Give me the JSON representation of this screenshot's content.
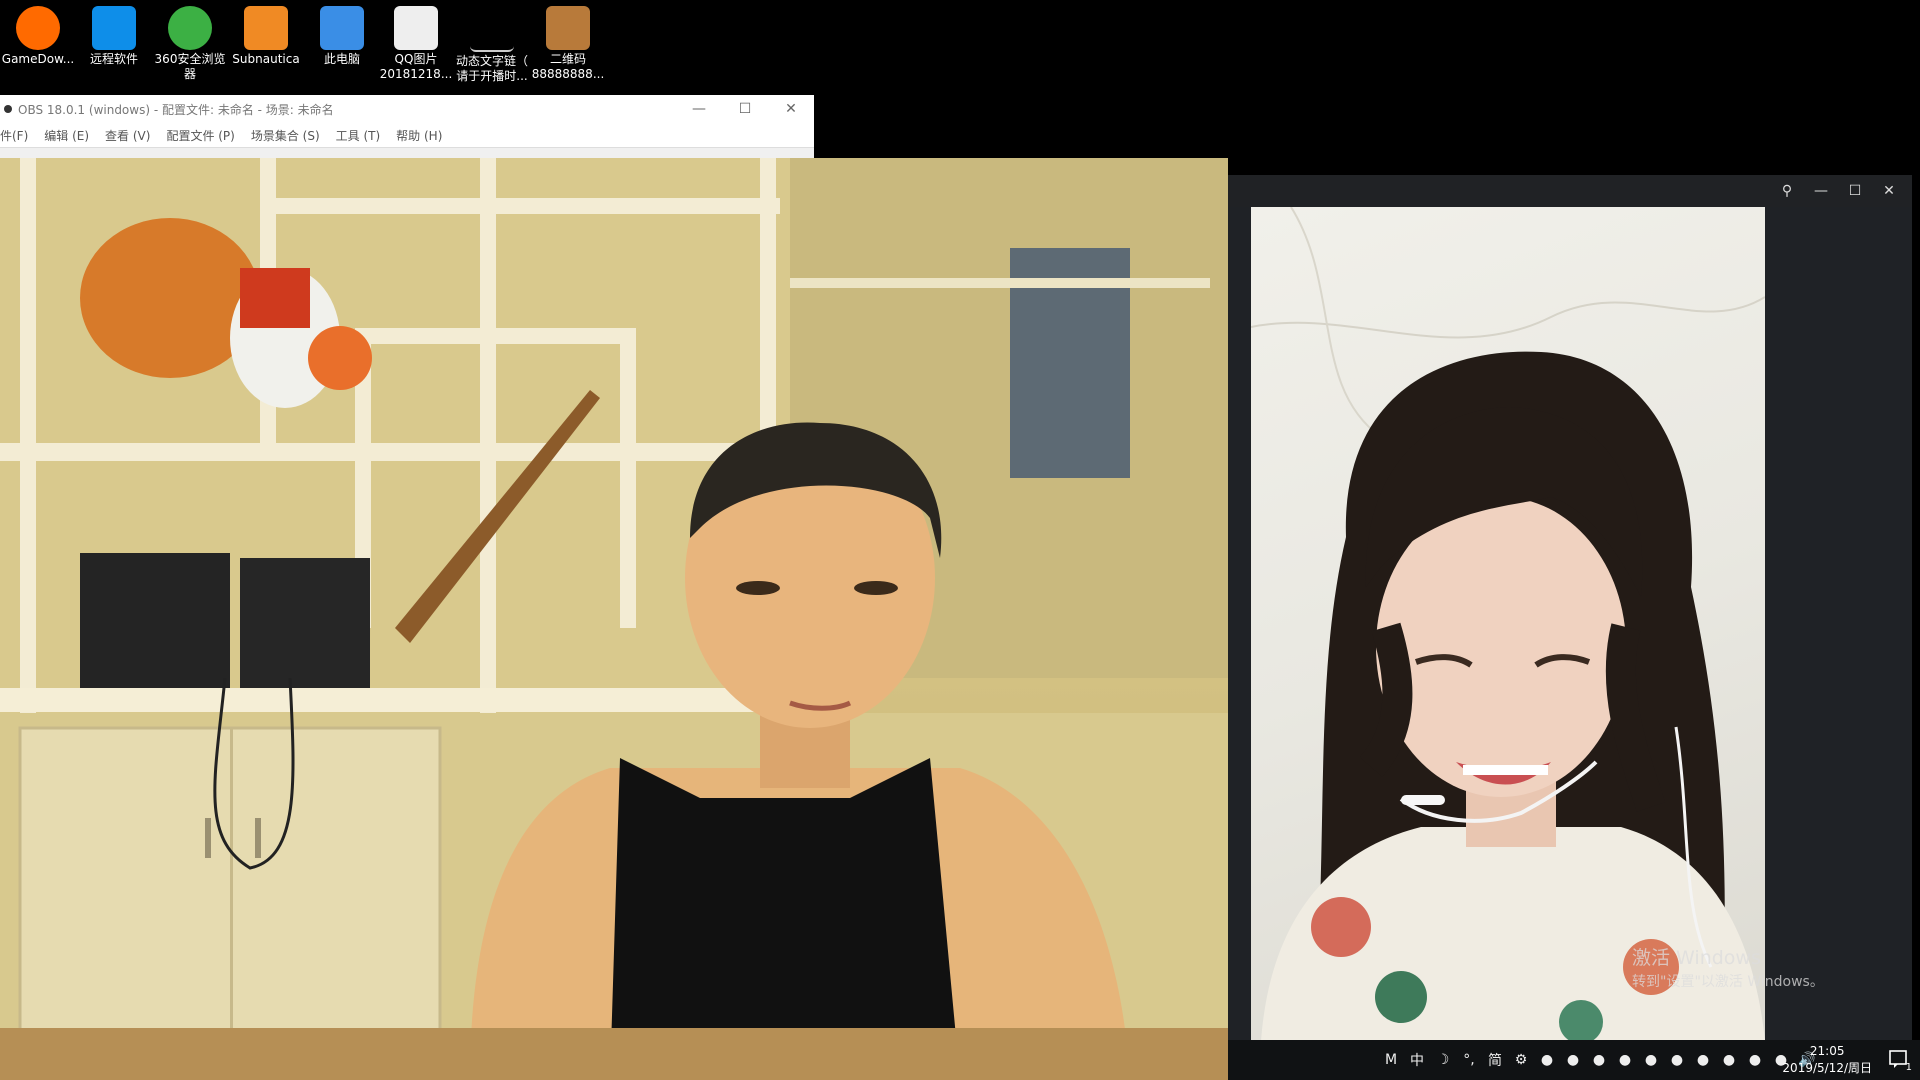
{
  "desktop": {
    "icons": [
      {
        "label": "GameDow...",
        "icon": "gamedownload-icon",
        "color": "#ff6a00"
      },
      {
        "label": "远程软件",
        "icon": "teamviewer-icon",
        "color": "#0e8ee9"
      },
      {
        "label": "360安全浏览\n器",
        "icon": "360-browser-icon",
        "color": "#3cb044"
      },
      {
        "label": "Subnautica",
        "icon": "subnautica-icon",
        "color": "#f08a24"
      },
      {
        "label": "此电脑",
        "icon": "this-pc-icon",
        "color": "#3a8ee6"
      },
      {
        "label": "QQ图片\n20181218...",
        "icon": "image-file-icon",
        "color": "#eeeeee"
      },
      {
        "label": "动态文字链（\n请于开播时...",
        "icon": "text-file-icon",
        "color": "#000000"
      },
      {
        "label": "二维码\n88888888...",
        "icon": "qrcode-image-icon",
        "color": "#b87a3a"
      }
    ]
  },
  "obs": {
    "title": "OBS 18.0.1 (windows) - 配置文件: 未命名 - 场景: 未命名",
    "menu": [
      "件(F)",
      "编辑 (E)",
      "查看 (V)",
      "配置文件 (P)",
      "场景集合 (S)",
      "工具 (T)",
      "帮助 (H)"
    ],
    "controls": {
      "minimize": "—",
      "maximize": "☐",
      "close": "✕"
    }
  },
  "video_window": {
    "controls": {
      "pin": "⚲",
      "minimize": "—",
      "maximize": "☐",
      "close": "✕"
    }
  },
  "watermark": {
    "line1": "激活 Windows",
    "line2": "转到\"设置\"以激活 Windows。"
  },
  "tray": {
    "icons": [
      "M",
      "中",
      "☽",
      "°,",
      "简",
      "⚙",
      "●",
      "●",
      "●",
      "●",
      "●",
      "●",
      "●",
      "●",
      "●",
      "●",
      "🔊"
    ],
    "time": "21:05",
    "date": "2019/5/12/周日",
    "notification_count": "1"
  }
}
